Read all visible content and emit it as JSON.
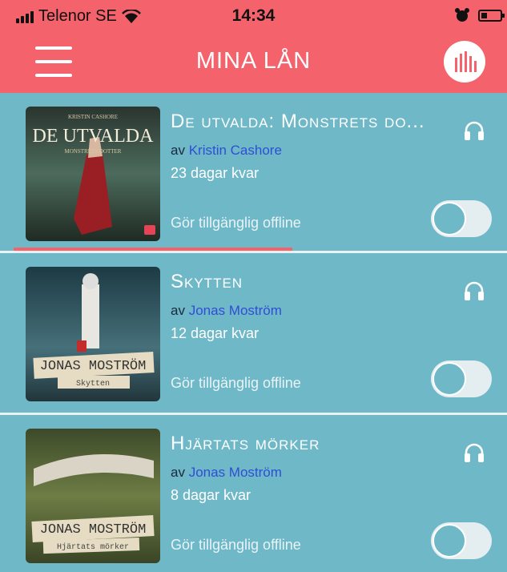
{
  "status_bar": {
    "carrier": "Telenor SE",
    "time": "14:34"
  },
  "nav": {
    "title": "MINA LÅN"
  },
  "loans": [
    {
      "title": "De utvalda: Monstrets do...",
      "author_prefix": "av",
      "author": "Kristin Cashore",
      "days_left": "23 dagar kvar",
      "offline_label": "Gör tillgänglig offline",
      "offline_enabled": false,
      "progress": 0.58,
      "cover_text_top": "KRISTIN CASHORE",
      "cover_text_main": "DE UTVALDA",
      "cover_text_sub": "MONSTRETS DOTTER"
    },
    {
      "title": "Skytten",
      "author_prefix": "av",
      "author": "Jonas Moström",
      "days_left": "12 dagar kvar",
      "offline_label": "Gör tillgänglig offline",
      "offline_enabled": false,
      "cover_text_main": "JONAS MOSTRÖM",
      "cover_text_sub": "Skytten"
    },
    {
      "title": "Hjärtats mörker",
      "author_prefix": "av",
      "author": "Jonas Moström",
      "days_left": "8 dagar kvar",
      "offline_label": "Gör tillgänglig offline",
      "offline_enabled": false,
      "cover_text_main": "JONAS MOSTRÖM",
      "cover_text_sub": "Hjärtats mörker"
    }
  ],
  "colors": {
    "accent": "#f4626b",
    "background": "#6fb8c7",
    "author_link": "#2f4ed6"
  },
  "icons": {
    "menu": "hamburger-icon",
    "player": "equalizer-icon",
    "audio": "headphones-icon"
  }
}
